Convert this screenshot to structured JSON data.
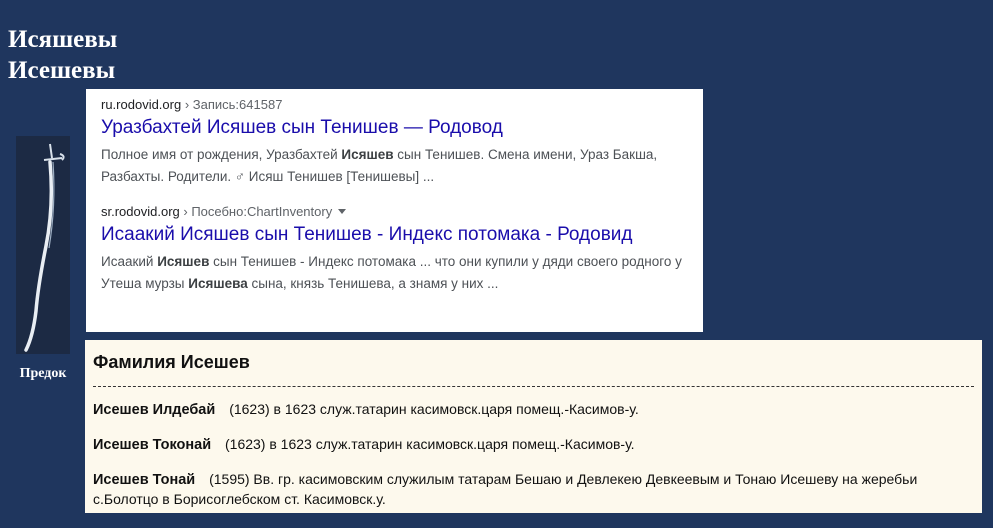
{
  "heading": {
    "line1": "Исяшевы",
    "line2": "Исешевы"
  },
  "ancestor": {
    "label": "Предок",
    "image_icon": "sword-icon"
  },
  "search_results": [
    {
      "url_domain": "ru.rodovid.org",
      "url_path": " › Запись:641587",
      "title": "Уразбахтей Исяшев сын Тенишев — Родовод",
      "snippet": [
        {
          "t": "Полное имя от рождения, Уразбахтей ",
          "b": false
        },
        {
          "t": "Исяшев",
          "b": true
        },
        {
          "t": " сын Тенишев. Смена имени, Ураз Бакша, Разбахты. Родители. ♂ Исяш Тенишев [Тенишевы] ...",
          "b": false
        }
      ]
    },
    {
      "url_domain": "sr.rodovid.org",
      "url_path": " › Посебно:ChartInventory",
      "title": "Исаакий Исяшев сын Тенишев - Индекс потомака - Родовид",
      "snippet": [
        {
          "t": "Исаакий ",
          "b": false
        },
        {
          "t": "Исяшев",
          "b": true
        },
        {
          "t": " сын Тенишев - Индекс потомака ... что они купили у дяди своего родного у Утеша мурзы ",
          "b": false
        },
        {
          "t": "Исяшева",
          "b": true
        },
        {
          "t": " сына, князь Тенишева, а знамя у них ...",
          "b": false
        }
      ]
    }
  ],
  "surname": {
    "title": "Фамилия Исешев",
    "records": [
      {
        "name": "Исешев Илдебай",
        "text": "(1623) в 1623 служ.татарин касимовск.царя помещ.-Касимов-у."
      },
      {
        "name": "Исешев Токонай",
        "text": "(1623) в 1623 служ.татарин касимовск.царя помещ.-Касимов-у."
      },
      {
        "name": "Исешев Тонай",
        "text": "(1595) Вв. гр. касимовским служилым татарам Бешаю и Девлекею Девкеевым и Тонаю Исешеву на жеребьи с.Болотцо в Борисоглебском ст. Касимовск.у."
      }
    ]
  }
}
